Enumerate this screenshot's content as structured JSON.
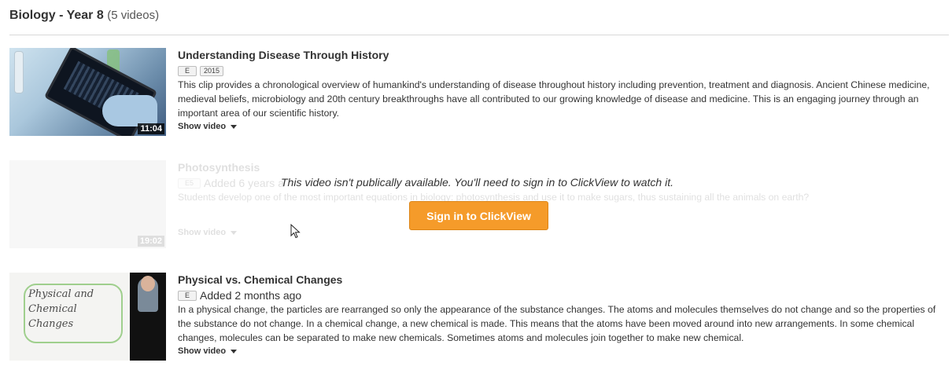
{
  "playlist": {
    "title": "Biology - Year 8",
    "count": "(5 videos)"
  },
  "videos": [
    {
      "title": "Understanding Disease Through History",
      "badge": "E",
      "year": "2015",
      "added": "",
      "description": "This clip provides a chronological overview of humankind's understanding of disease throughout history including prevention, treatment and diagnosis. Ancient Chinese medicine, medieval beliefs, microbiology and 20th century breakthroughs have all contributed to our growing knowledge of disease and medicine. This is an engaging journey through an important area of our scientific history.",
      "duration": "11:04",
      "show_label": "Show video"
    },
    {
      "title": "Photosynthesis",
      "badge": "E5",
      "added": "Added 6 years a",
      "description": "Students develop one of the most important equations in biology: photosynthesis and use it to make sugars, thus sustaining all the animals on earth?",
      "duration": "19:02",
      "show_label": "Show video"
    },
    {
      "title": "Physical vs. Chemical Changes",
      "badge": "E",
      "added": "Added 2 months ago",
      "description": "In a physical change, the particles are rearranged so only the appearance of the substance changes. The atoms and molecules themselves do not change and so the properties of the substance do not change. In a chemical change, a new chemical is made. This means that the atoms have been moved around into new arrangements. In some chemical changes, molecules can be separated to make new chemicals. Sometimes atoms and molecules join together to make new chemical.",
      "thumb_text": [
        "Physical and",
        "Chemical",
        "Changes"
      ],
      "show_label": "Show video"
    }
  ],
  "locked": {
    "message": "This video isn't publically available. You'll need to sign in to ClickView to watch it.",
    "button_label": "Sign in to ClickView"
  },
  "colors": {
    "accent": "#f59b2a",
    "text": "#333333",
    "rule": "#d9d9d9"
  }
}
